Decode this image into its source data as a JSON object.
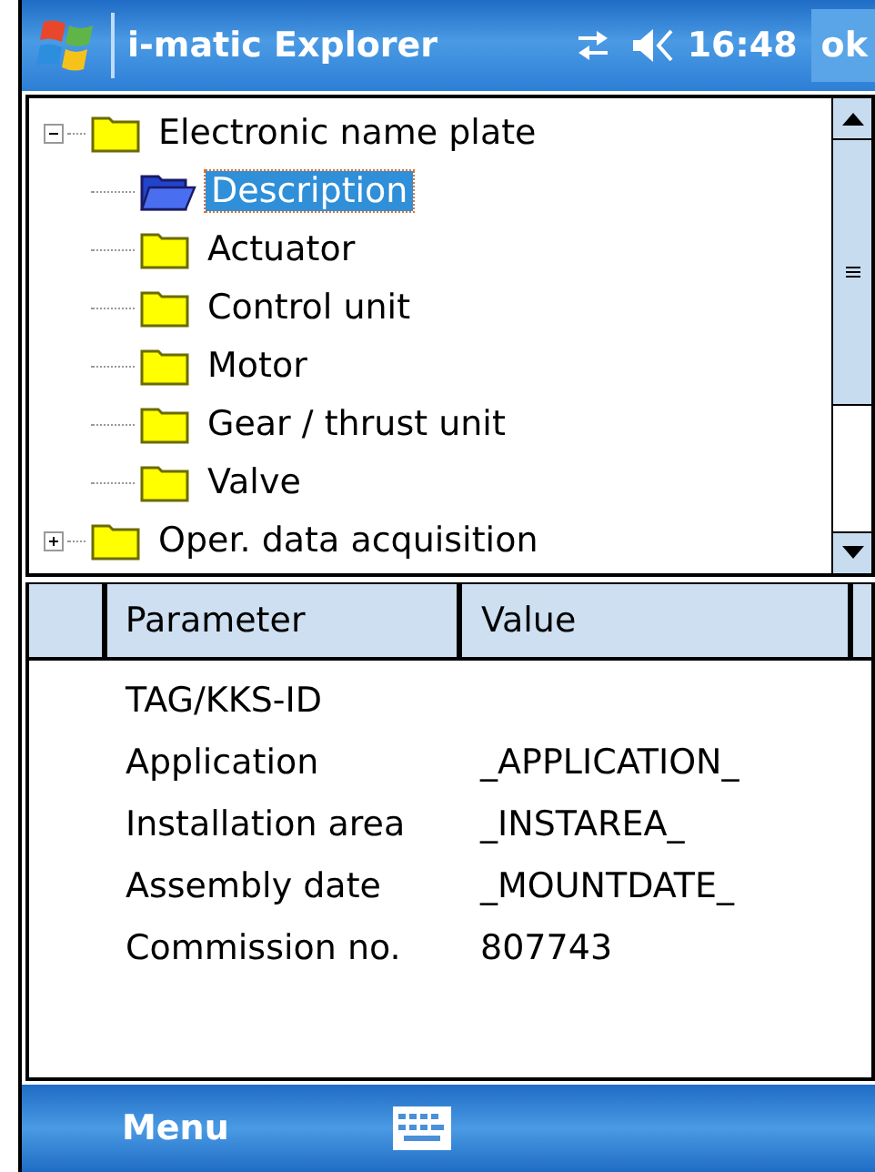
{
  "title_bar": {
    "title": "i-matic Explorer",
    "time": "16:48",
    "ok": "ok"
  },
  "tree": [
    {
      "label": "Electronic name plate",
      "expanded": true,
      "selected": false,
      "children": [
        {
          "label": "Description",
          "selected": true
        },
        {
          "label": "Actuator",
          "selected": false
        },
        {
          "label": "Control unit",
          "selected": false
        },
        {
          "label": "Motor",
          "selected": false
        },
        {
          "label": "Gear / thrust unit",
          "selected": false
        },
        {
          "label": "Valve",
          "selected": false
        }
      ]
    },
    {
      "label": "Oper. data acquisition",
      "expanded": false,
      "selected": false
    }
  ],
  "table": {
    "columns": [
      "Parameter",
      "Value"
    ],
    "rows": [
      {
        "parameter": "TAG/KKS-ID"
      },
      {
        "parameter": "Application",
        "value": "_APPLICATION_"
      },
      {
        "parameter": "Installation area",
        "value": "_INSTAREA_"
      },
      {
        "parameter": "Assembly date",
        "value": "_MOUNTDATE_"
      },
      {
        "parameter": "Commission no.",
        "value": "807743"
      }
    ]
  },
  "menu_bar": {
    "menu": "Menu"
  }
}
